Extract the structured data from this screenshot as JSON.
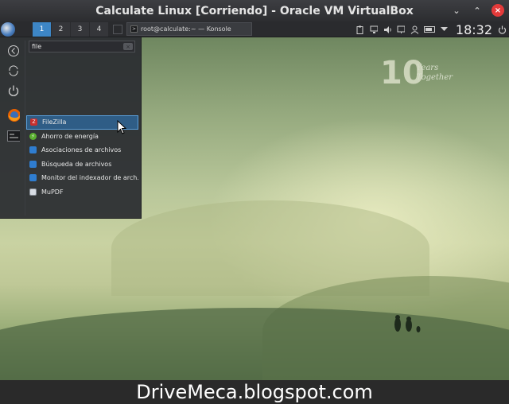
{
  "window": {
    "title": "Calculate Linux [Corriendo] - Oracle VM VirtualBox",
    "buttons": {
      "minimize": "⌄",
      "maximize": "⌃",
      "close": "×"
    }
  },
  "panel": {
    "desktops": [
      "1",
      "2",
      "3",
      "4"
    ],
    "active_desktop": "1",
    "task": {
      "label": "root@calculate:~ — Konsole",
      "icon": ">"
    },
    "tray_icons": [
      "clipboard-icon",
      "network-icon",
      "volume-icon",
      "display-icon",
      "user-icon",
      "battery-icon",
      "expand-icon"
    ],
    "clock": "18:32"
  },
  "launcher": {
    "search_value": "file",
    "search_clear": "×",
    "sidebar": [
      "back-icon",
      "refresh-icon",
      "power-icon",
      "firefox-icon",
      "konsole-icon"
    ],
    "results": [
      {
        "label": "FileZilla",
        "color": "#c8302e",
        "glyph": "Z",
        "selected": true
      },
      {
        "label": "Ahorro de energía",
        "color": "#5ab030",
        "glyph": "⚡"
      },
      {
        "label": "Asociaciones de archivos",
        "color": "#2f7dd0",
        "glyph": ""
      },
      {
        "label": "Búsqueda de archivos",
        "color": "#2f7dd0",
        "glyph": ""
      },
      {
        "label": "Monitor del indexador de arch…",
        "color": "#2f7dd0",
        "glyph": ""
      },
      {
        "label": "MuPDF",
        "color": "#d8dde4",
        "glyph": ""
      }
    ]
  },
  "wallpaper": {
    "watermark_number": "10",
    "watermark_line1": "Years",
    "watermark_line2": "Together"
  },
  "banner": {
    "text": "DriveMeca.blogspot.com"
  }
}
